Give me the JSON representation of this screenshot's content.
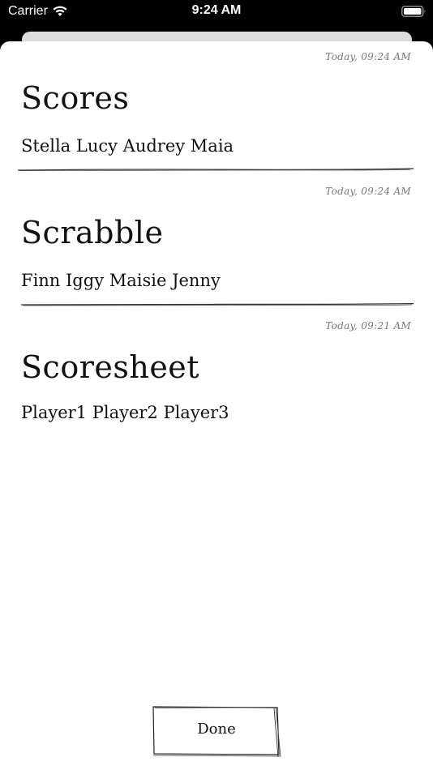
{
  "status_bar": {
    "carrier": "Carrier",
    "time": "9:24 AM"
  },
  "entries": [
    {
      "timestamp": "Today, 09:24 AM",
      "title": "Scores",
      "players": "Stella Lucy Audrey Maia"
    },
    {
      "timestamp": "Today, 09:24 AM",
      "title": "Scrabble",
      "players": "Finn Iggy Maisie Jenny"
    },
    {
      "timestamp": "Today, 09:21 AM",
      "title": "Scoresheet",
      "players": "Player1 Player2 Player3"
    }
  ],
  "done_button": {
    "label": "Done"
  }
}
